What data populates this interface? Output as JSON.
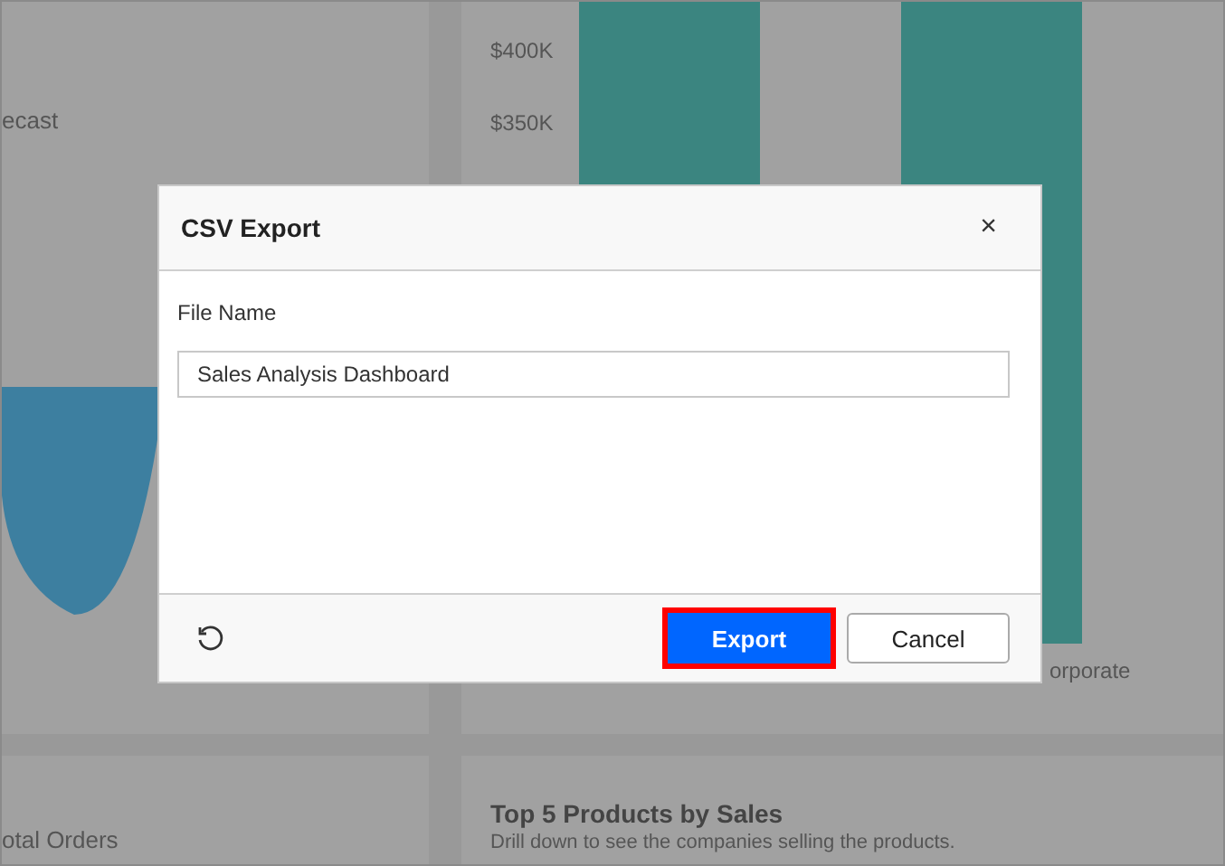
{
  "background": {
    "forecast_panel": {
      "title": "ecast"
    },
    "bar_chart_panel": {
      "y_axis_labels": [
        "$400K",
        "$350K"
      ],
      "category_label": "orporate"
    },
    "orders_panel": {
      "title": "otal Orders"
    },
    "products_panel": {
      "title": "Top 5 Products by Sales",
      "subtitle": "Drill down to see the companies selling the products."
    }
  },
  "dialog": {
    "title": "CSV Export",
    "close": "×",
    "field": {
      "label": "File Name",
      "value": "Sales Analysis Dashboard"
    },
    "buttons": [
      {
        "label": "Export",
        "kind": "primary",
        "highlighted": true
      },
      {
        "label": "Cancel",
        "kind": "secondary",
        "highlighted": false
      }
    ]
  }
}
